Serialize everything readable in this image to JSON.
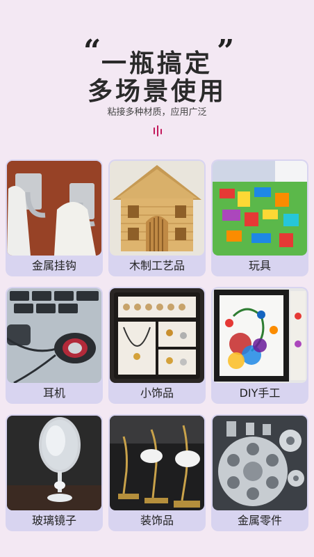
{
  "header": {
    "title_line1": "一瓶搞定",
    "title_line2": "多场景使用",
    "subtitle": "粘接多种材质，应用广泛",
    "quote_open": "“",
    "quote_close": "”"
  },
  "grid": {
    "items": [
      {
        "label": "金属挂钩"
      },
      {
        "label": "木制工艺品"
      },
      {
        "label": "玩具"
      },
      {
        "label": "耳机"
      },
      {
        "label": "小饰品"
      },
      {
        "label": "DIY手工"
      },
      {
        "label": "玻璃镜子"
      },
      {
        "label": "装饰品"
      },
      {
        "label": "金属零件"
      }
    ]
  },
  "colors": {
    "background": "#f3e8f3",
    "card": "#d8d4f0",
    "accent": "#c2185b"
  }
}
